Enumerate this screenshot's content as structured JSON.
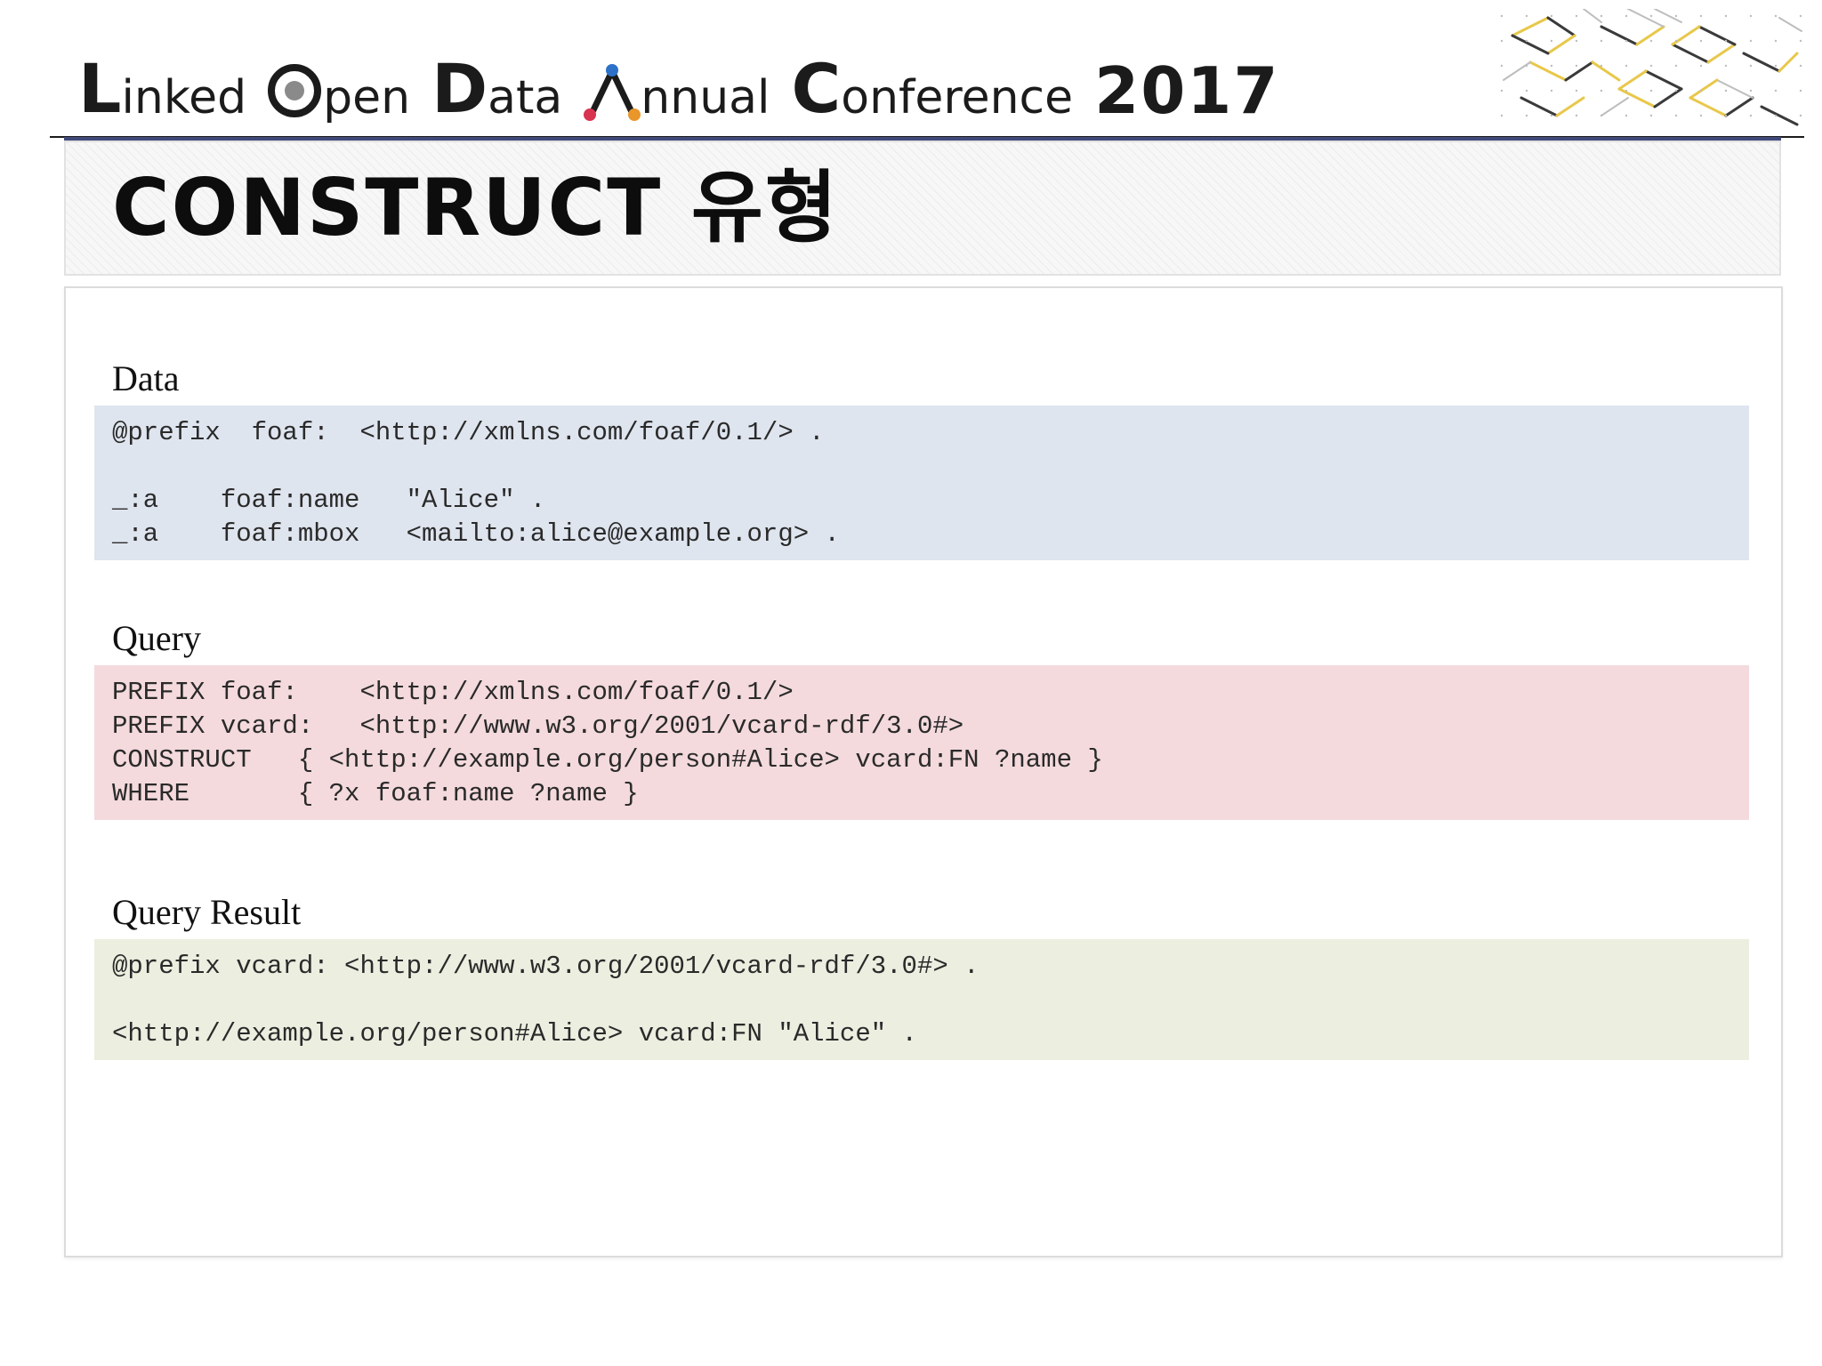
{
  "header": {
    "conference_words": [
      {
        "cap": "L",
        "rest": "inked"
      },
      {
        "cap": "O",
        "rest": "pen"
      },
      {
        "cap": "D",
        "rest": "ata"
      },
      {
        "cap": "A",
        "rest": "nnual"
      },
      {
        "cap": "C",
        "rest": "onference"
      }
    ],
    "year": "2017",
    "logo_dot_colors": [
      "#d8344f",
      "#2d72c8",
      "#e9962a"
    ],
    "pattern_icon": "geometric-cube-pattern-icon",
    "pattern_colors": [
      "#e8c84a",
      "#3a3a3a",
      "#bdbdbd"
    ]
  },
  "title": "CONSTRUCT 유형",
  "sections": {
    "data": {
      "label": "Data",
      "background": "#dfe5ef",
      "lines": [
        "@prefix  foaf:  <http://xmlns.com/foaf/0.1/> .",
        "",
        "_:a    foaf:name   \"Alice\" .",
        "_:a    foaf:mbox   <mailto:alice@example.org> ."
      ]
    },
    "query": {
      "label": "Query",
      "background": "#f4dadd",
      "lines": [
        "PREFIX foaf:    <http://xmlns.com/foaf/0.1/>",
        "PREFIX vcard:   <http://www.w3.org/2001/vcard-rdf/3.0#>",
        "CONSTRUCT   { <http://example.org/person#Alice> vcard:FN ?name }",
        "WHERE       { ?x foaf:name ?name }"
      ]
    },
    "result": {
      "label": "Query Result",
      "background": "#eceee0",
      "lines": [
        "@prefix vcard: <http://www.w3.org/2001/vcard-rdf/3.0#> .",
        "",
        "<http://example.org/person#Alice> vcard:FN \"Alice\" ."
      ]
    }
  }
}
